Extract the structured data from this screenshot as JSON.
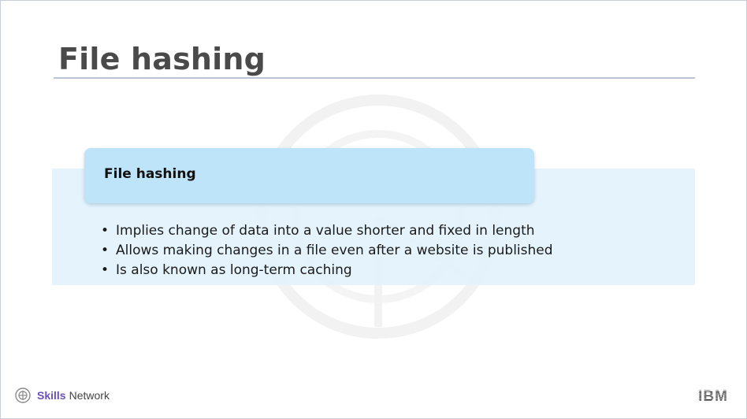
{
  "slide": {
    "title": "File hashing"
  },
  "card": {
    "header": "File hashing",
    "bullets": [
      "Implies change of data into a value shorter and fixed in length",
      "Allows making changes in a file even after a website is published",
      "Is also known as long-term caching"
    ]
  },
  "footer": {
    "brand_bold": "Skills",
    "brand_regular": "Network",
    "brand_color": "#6b4fbb",
    "logo_icon": "skills-network-logo-icon",
    "corporate_logo": "IBM",
    "corporate_logo_icon": "ibm-logo-icon"
  },
  "colors": {
    "title_text": "#4a4a4a",
    "title_rule": "#bcc3d6",
    "header_box": "#bde4f9",
    "content_band": "#e1f3fc"
  }
}
